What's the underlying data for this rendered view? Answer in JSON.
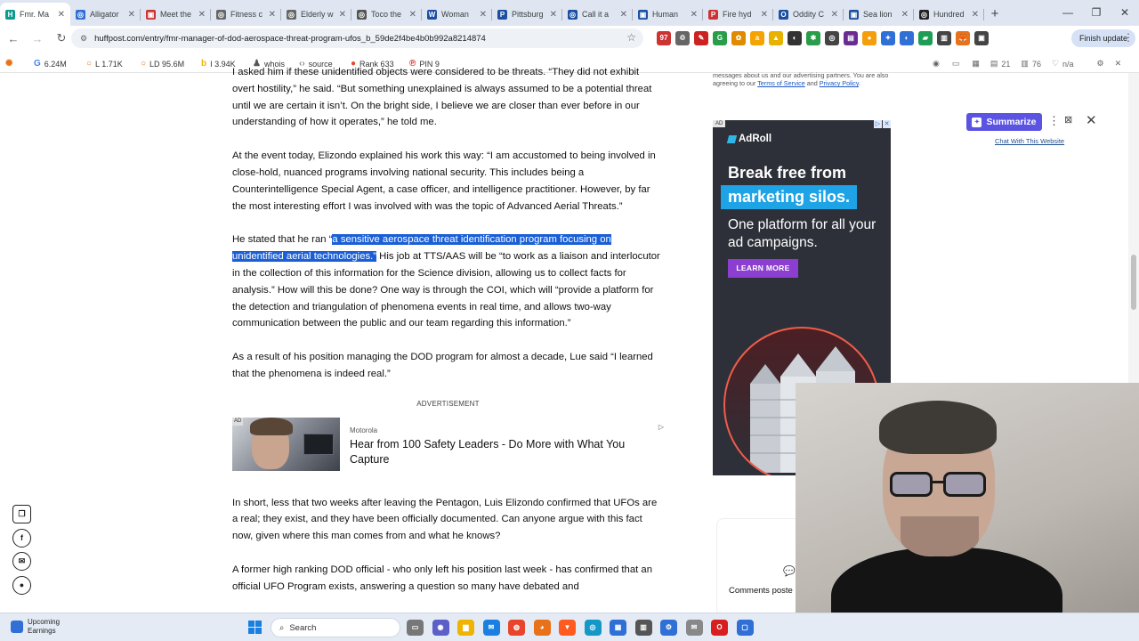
{
  "browser": {
    "tabs": [
      {
        "label": "Fmr. Ma",
        "color": "#0a9c8e",
        "glyph": "H",
        "active": true
      },
      {
        "label": "Alligator",
        "color": "#2f6fd6",
        "glyph": "◎"
      },
      {
        "label": "Meet the",
        "color": "#c33",
        "glyph": "▣"
      },
      {
        "label": "Fitness c",
        "color": "#666",
        "glyph": "◎"
      },
      {
        "label": "Elderly w",
        "color": "#666",
        "glyph": "◎"
      },
      {
        "label": "Toco the",
        "color": "#555",
        "glyph": "◎"
      },
      {
        "label": "Woman",
        "color": "#1b4fa3",
        "glyph": "W"
      },
      {
        "label": "Pittsburg",
        "color": "#1b4fa3",
        "glyph": "P"
      },
      {
        "label": "Call it a",
        "color": "#1b4fa3",
        "glyph": "◎"
      },
      {
        "label": "Human",
        "color": "#1b4fa3",
        "glyph": "▣"
      },
      {
        "label": "Fire hyd",
        "color": "#c33",
        "glyph": "P"
      },
      {
        "label": "Oddity C",
        "color": "#1b4fa3",
        "glyph": "O"
      },
      {
        "label": "Sea lion",
        "color": "#1b4fa3",
        "glyph": "▣"
      },
      {
        "label": "Hundred",
        "color": "#222",
        "glyph": "◎"
      }
    ],
    "new_tab": "+",
    "url": "huffpost.com/entry/fmr-manager-of-dod-aerospace-threat-program-ufos_b_59de2f4be4b0b992a8214874",
    "finish_update": "Finish update",
    "extensions": [
      {
        "color": "#c33",
        "glyph": "97"
      },
      {
        "color": "#666",
        "glyph": "♲"
      },
      {
        "color": "#c22",
        "glyph": "✎"
      },
      {
        "color": "#2a9d4a",
        "glyph": "G"
      },
      {
        "color": "#e08a00",
        "glyph": "✿"
      },
      {
        "color": "#f5a300",
        "glyph": "a"
      },
      {
        "color": "#e8b200",
        "glyph": "▲"
      },
      {
        "color": "#333",
        "glyph": "◐"
      },
      {
        "color": "#2a9d4a",
        "glyph": "✱"
      },
      {
        "color": "#444",
        "glyph": "◎"
      },
      {
        "color": "#6a2c91",
        "glyph": "▤"
      },
      {
        "color": "#f59e0b",
        "glyph": "●"
      },
      {
        "color": "#2f6fd6",
        "glyph": "✦"
      },
      {
        "color": "#2f6fd6",
        "glyph": "◐"
      },
      {
        "color": "#1e9e55",
        "glyph": "▰"
      },
      {
        "color": "#444",
        "glyph": "▥"
      },
      {
        "color": "#e8711a",
        "glyph": "🦊"
      },
      {
        "color": "#444",
        "glyph": "▣"
      }
    ]
  },
  "seo": {
    "google": "6.24M",
    "links": "L 1.71K",
    "ld": "LD 95.6M",
    "index": "I 3.94K",
    "whois": "whois",
    "source": "source",
    "rank": "Rank 633",
    "pin": "PIN 9",
    "right_a": "21",
    "right_b": "76",
    "right_c": "n/a"
  },
  "article": {
    "p1": "I asked him if these unidentified objects were considered to be threats. “They did not exhibit overt hostility,” he said. “But something unexplained is always assumed to be a potential threat until we are certain it isn’t. On the bright side, I believe we are closer than ever before in our understanding of how it operates,” he told me.",
    "p2": "At the event today, Elizondo explained his work this way: “I am accustomed to being involved in close-hold, nuanced programs involving national security. This includes being a Counterintelligence Special Agent, a case officer, and intelligence practitioner. However, by far the most interesting effort I was involved with was the topic of Advanced Aerial Threats.”",
    "p3_pre": "He stated that he ran “",
    "p3_hl": "a sensitive aerospace threat identification program focusing on unidentified aerial technologies.”",
    "p3_post": " His job at TTS/AAS will be “to work as a liaison and interlocutor in the collection of this information for the Science division, allowing us to collect facts for analysis.” How will this be done? One way is through the COI, which will “provide a platform for the detection and triangulation of phenomena events in real time, and allows two-way communication between the public and our team regarding this information.”",
    "p4": "As a result of his position managing the DOD program for almost a decade, Lue said “I learned that the phenomena is indeed real.”",
    "ad_label": "ADVERTISEMENT",
    "promo": {
      "ad": "AD",
      "source": "Motorola",
      "title": "Hear from 100 Safety Leaders - Do More with What You Capture"
    },
    "p5": "In short, less that two weeks after leaving the Pentagon, Luis Elizondo confirmed that UFOs are a real; they exist, and they have been officially documented. Can anyone argue with this fact now, given where this man comes from and what he knows?",
    "p6": "A former high ranking DOD official - who only left his position last week - has confirmed that an official UFO Program exists, answering a question so many have debated and"
  },
  "sidebar": {
    "terms_pre": "messages about us and our advertising partners. You are also agreeing to our ",
    "terms_link": "Terms of Service",
    "terms_mid": " and ",
    "privacy_link": "Privacy Policy",
    "terms_end": ".",
    "ad": {
      "tag": "AD",
      "brand": "AdRoll",
      "headline1": "Break free from",
      "headline2": "marketing silos.",
      "sub": "One platform for all your ad campaigns.",
      "cta": "LEARN MORE"
    },
    "comments_label": "Comments poste"
  },
  "summarize": {
    "button": "Summarize",
    "chat": "Chat With This Website"
  },
  "taskbar": {
    "weather_title": "Upcoming",
    "weather_sub": "Earnings",
    "search": "Search",
    "apps": [
      {
        "color": "#777",
        "glyph": "▭"
      },
      {
        "color": "#5b5fc7",
        "glyph": "◉"
      },
      {
        "color": "#f0b400",
        "glyph": "▆"
      },
      {
        "color": "#1a7fe0",
        "glyph": "✉"
      },
      {
        "color": "#e8452c",
        "glyph": "◍"
      },
      {
        "color": "#e8711a",
        "glyph": "◕"
      },
      {
        "color": "#ff5a1f",
        "glyph": "▼"
      },
      {
        "color": "#1398c8",
        "glyph": "◎"
      },
      {
        "color": "#2f6fd6",
        "glyph": "▦"
      },
      {
        "color": "#555",
        "glyph": "▥"
      },
      {
        "color": "#2f6fd6",
        "glyph": "⚙"
      },
      {
        "color": "#888",
        "glyph": "✉"
      },
      {
        "color": "#d81e1e",
        "glyph": "O"
      },
      {
        "color": "#2f6fd6",
        "glyph": "▢"
      }
    ]
  }
}
